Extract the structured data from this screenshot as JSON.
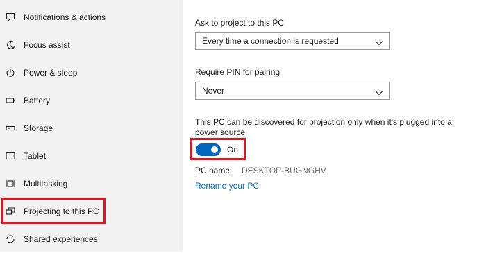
{
  "sidebar": {
    "items": [
      {
        "label": "Notifications & actions",
        "icon": "notification-icon"
      },
      {
        "label": "Focus assist",
        "icon": "moon-icon"
      },
      {
        "label": "Power & sleep",
        "icon": "power-icon"
      },
      {
        "label": "Battery",
        "icon": "battery-icon"
      },
      {
        "label": "Storage",
        "icon": "storage-icon"
      },
      {
        "label": "Tablet",
        "icon": "tablet-icon"
      },
      {
        "label": "Multitasking",
        "icon": "multitasking-icon"
      },
      {
        "label": "Projecting to this PC",
        "icon": "projecting-icon",
        "selected": true
      },
      {
        "label": "Shared experiences",
        "icon": "shared-experiences-icon"
      }
    ]
  },
  "main": {
    "ask_label": "Ask to project to this PC",
    "ask_value": "Every time a connection is requested",
    "pin_label": "Require PIN for pairing",
    "pin_value": "Never",
    "power_description": "This PC can be discovered for projection only when it's plugged into a power source",
    "toggle": {
      "state": "On",
      "checked": true
    },
    "pc_name_label": "PC name",
    "pc_name_value": "DESKTOP-BUGNGHV",
    "rename_link": "Rename your PC"
  },
  "colors": {
    "accent": "#0067c0",
    "highlight": "#e0141e",
    "sidebar_bg": "#f2f2f2"
  }
}
